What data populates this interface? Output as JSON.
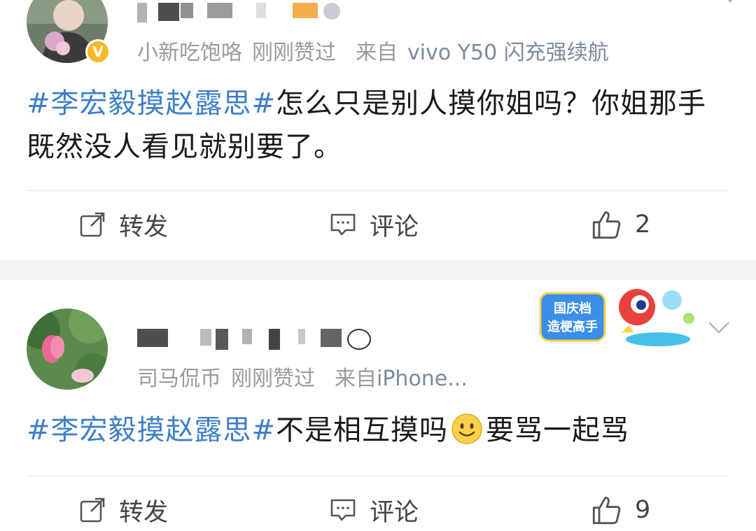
{
  "post1": {
    "meta": {
      "user_desc": "小新吃饱咯",
      "liked": "刚刚赞过",
      "source_prefix": "来自",
      "source": "vivo Y50 闪充强续航"
    },
    "content": {
      "hashtag": "#李宏毅摸赵露思#",
      "text": "怎么只是别人摸你姐吗？你姐那手既然没人看见就别要了。"
    },
    "actions": {
      "repost": "转发",
      "comment": "评论",
      "like_count": "2"
    }
  },
  "post2": {
    "meta": {
      "user_desc": "司马侃币",
      "liked": "刚刚赞过",
      "source_prefix": "来自",
      "source": "iPhone..."
    },
    "content": {
      "hashtag": "#李宏毅摸赵露思#",
      "text_before": "不是相互摸吗",
      "text_after": "要骂一起骂"
    },
    "actions": {
      "repost": "转发",
      "comment": "评论",
      "like_count": "9"
    },
    "badge": {
      "line1": "国庆档",
      "line2": "造梗高手"
    }
  },
  "colors": {
    "hashtag": "#3d7fc8",
    "meta": "#9a9a9a",
    "verified": "#fbb925",
    "gap": "#f2f2f2"
  },
  "icons": [
    "repost-icon",
    "comment-icon",
    "like-icon",
    "chevron-down-icon",
    "verified-icon",
    "smile-emoji-icon"
  ]
}
